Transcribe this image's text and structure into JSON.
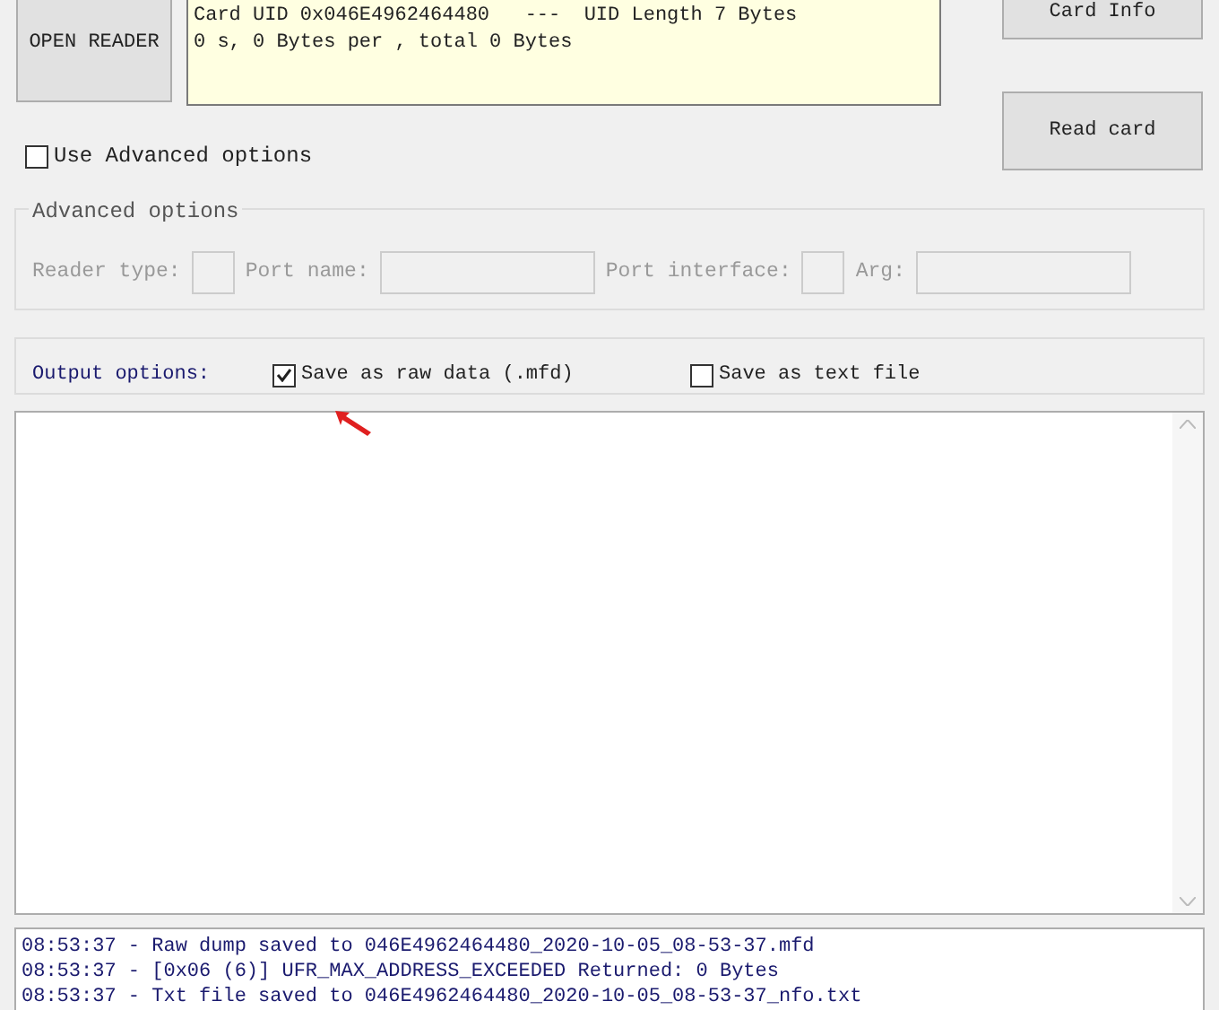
{
  "buttons": {
    "open_reader": "OPEN READER",
    "card_info": "Card Info",
    "read_card": "Read card"
  },
  "info_lines": [
    "Card UID 0x046E4962464480   ---  UID Length 7 Bytes",
    "0 s, 0 Bytes per , total 0 Bytes"
  ],
  "use_advanced": {
    "label": "Use Advanced options",
    "checked": false
  },
  "advanced": {
    "title": "Advanced options",
    "disabled": true,
    "fields": [
      {
        "label": "Reader type:",
        "kind": "small"
      },
      {
        "label": "Port name:",
        "kind": "wide"
      },
      {
        "label": "Port interface:",
        "kind": "small"
      },
      {
        "label": "Arg:",
        "kind": "wide"
      }
    ]
  },
  "output": {
    "label": "Output options:",
    "options": [
      {
        "label": "Save as raw data (.mfd)",
        "checked": true
      },
      {
        "label": "Save as text file",
        "checked": false
      }
    ]
  },
  "log": [
    "08:53:37 - Raw dump saved to 046E4962464480_2020-10-05_08-53-37.mfd",
    "08:53:37 - [0x06 (6)] UFR_MAX_ADDRESS_EXCEEDED Returned: 0 Bytes",
    "08:53:37 - Txt file saved to 046E4962464480_2020-10-05_08-53-37_nfo.txt"
  ]
}
